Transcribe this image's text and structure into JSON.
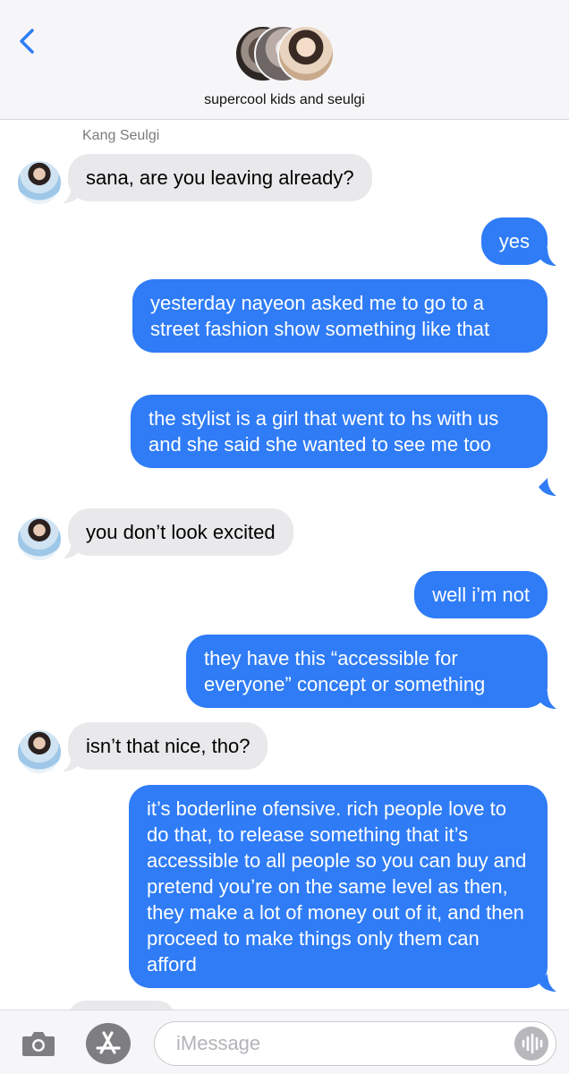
{
  "header": {
    "group_name": "supercool kids and seulgi",
    "back_icon": "chevron-left-icon",
    "accent": "#2f7cf6"
  },
  "sender_name": "Kang Seulgi",
  "messages": [
    {
      "from": "incoming",
      "text": "sana, are you leaving already?"
    },
    {
      "from": "outgoing",
      "text": "yes"
    },
    {
      "from": "outgoing",
      "text": "yesterday nayeon asked me to go to a street fashion show something like that"
    },
    {
      "from": "outgoing",
      "text": "the stylist is a girl that went to hs with us and she said she wanted to see me too"
    },
    {
      "from": "incoming",
      "text": "you don’t look excited"
    },
    {
      "from": "outgoing",
      "text": "well i’m not"
    },
    {
      "from": "outgoing",
      "text": "they have this “accessible for everyone” concept or something"
    },
    {
      "from": "incoming",
      "text": "isn’t that nice, tho?"
    },
    {
      "from": "outgoing",
      "text": "it’s boderline ofensive. rich people love to do that, to release something that it’s accessible to all people so you can buy and pretend you’re on the same level as then, they make a lot of money out of it, and then proceed to make things only them can afford"
    }
  ],
  "toolbar": {
    "placeholder": "iMessage",
    "camera_icon": "camera-icon",
    "apps_icon": "app-store-icon",
    "audio_icon": "audio-waveform-icon"
  },
  "colors": {
    "incoming_bubble": "#e9e9eb",
    "outgoing_bubble": "#2f7cf6"
  }
}
